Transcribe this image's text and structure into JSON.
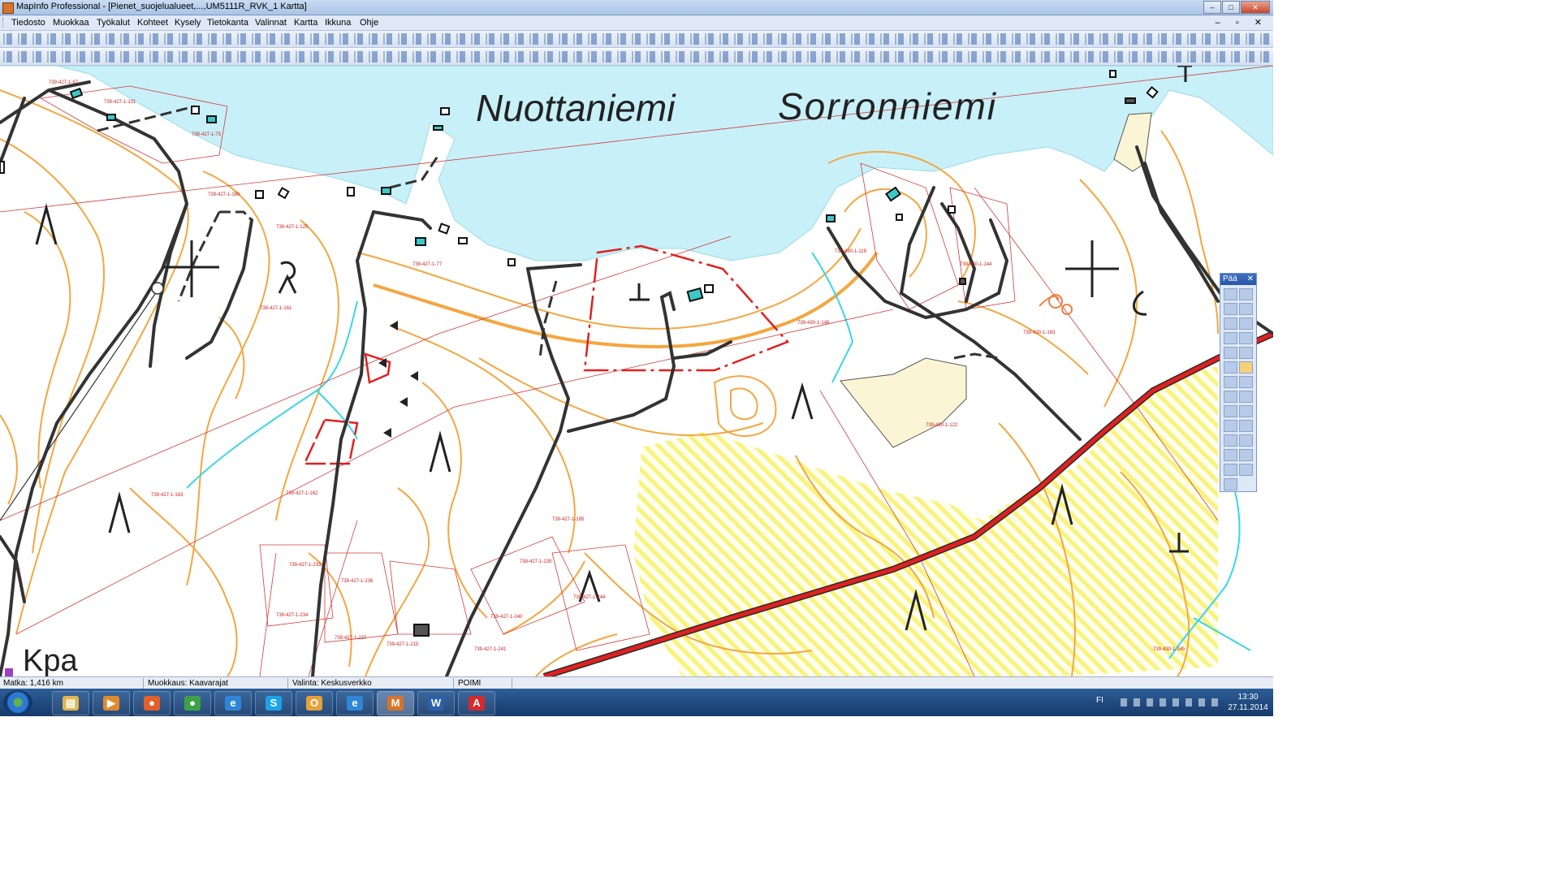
{
  "window": {
    "title": "MapInfo Professional - [Pienet_suojelualueet,...,UM5111R_RVK_1 Kartta]",
    "controls": {
      "minimize": "–",
      "maximize": "□",
      "close": "✕"
    }
  },
  "menubar": {
    "items": [
      "Tiedosto",
      "Muokkaa",
      "Työkalut",
      "Kohteet",
      "Kysely",
      "Tietokanta",
      "Valinnat",
      "Kartta",
      "Ikkuna",
      "Ohje"
    ],
    "mdi_controls": "– ▫ ✕"
  },
  "map": {
    "place_labels": [
      "Nuottaniemi",
      "Sorronniemi",
      "Kpa"
    ],
    "parcel_labels": [
      "739-427-1-97",
      "739-427-1-101",
      "739-427-1-75",
      "739-427-1-160",
      "739-427-1-125",
      "739-427-1-161",
      "739-427-1-77",
      "739-427-1-163",
      "739-427-1-162",
      "739-427-1-233",
      "739-427-1-236",
      "739-427-1-234",
      "739-427-1-237",
      "739-427-1-215",
      "739-427-1-239",
      "739-427-1-240",
      "739-427-1-241",
      "739-427-1-244",
      "739-427-1-195",
      "739-430-1-119",
      "739-430-1-148",
      "739-430-1-163",
      "739-430-1-145",
      "739-430-1-144",
      "739-430-1-122"
    ],
    "colors": {
      "water": "#c8f0f8",
      "contour": "#f4a640",
      "road": "#303030",
      "main_road": "#e02020",
      "parcel_line": "#d23a3a",
      "protected_hatch": "#f6f05a",
      "field": "#fbf5d6",
      "stream": "#38d6e6"
    }
  },
  "tool_palette": {
    "title": "Pää",
    "close": "✕"
  },
  "statusbar": {
    "distance": "Matka: 1,416 km",
    "editing": "Muokkaus: Kaavarajat",
    "selection": "Valinta: Keskusverkko",
    "mode": "POIMI"
  },
  "taskbar": {
    "apps": [
      {
        "name": "explorer",
        "glyph": "▤",
        "color": "#e0b650"
      },
      {
        "name": "media-player",
        "glyph": "▶",
        "color": "#e08a2a"
      },
      {
        "name": "firefox",
        "glyph": "●",
        "color": "#e2602a"
      },
      {
        "name": "chrome",
        "glyph": "●",
        "color": "#3da14a"
      },
      {
        "name": "internet-explorer",
        "glyph": "e",
        "color": "#2f86d6"
      },
      {
        "name": "skype",
        "glyph": "S",
        "color": "#1aa3e8"
      },
      {
        "name": "outlook",
        "glyph": "O",
        "color": "#e6a23a"
      },
      {
        "name": "internet-explorer-2",
        "glyph": "e",
        "color": "#2f86d6"
      },
      {
        "name": "mapinfo",
        "glyph": "M",
        "color": "#d8742a"
      },
      {
        "name": "word",
        "glyph": "W",
        "color": "#2b5faa"
      },
      {
        "name": "acrobat",
        "glyph": "A",
        "color": "#d42a2a"
      }
    ],
    "language": "FI",
    "time": "13:30",
    "date": "27.11.2014"
  }
}
